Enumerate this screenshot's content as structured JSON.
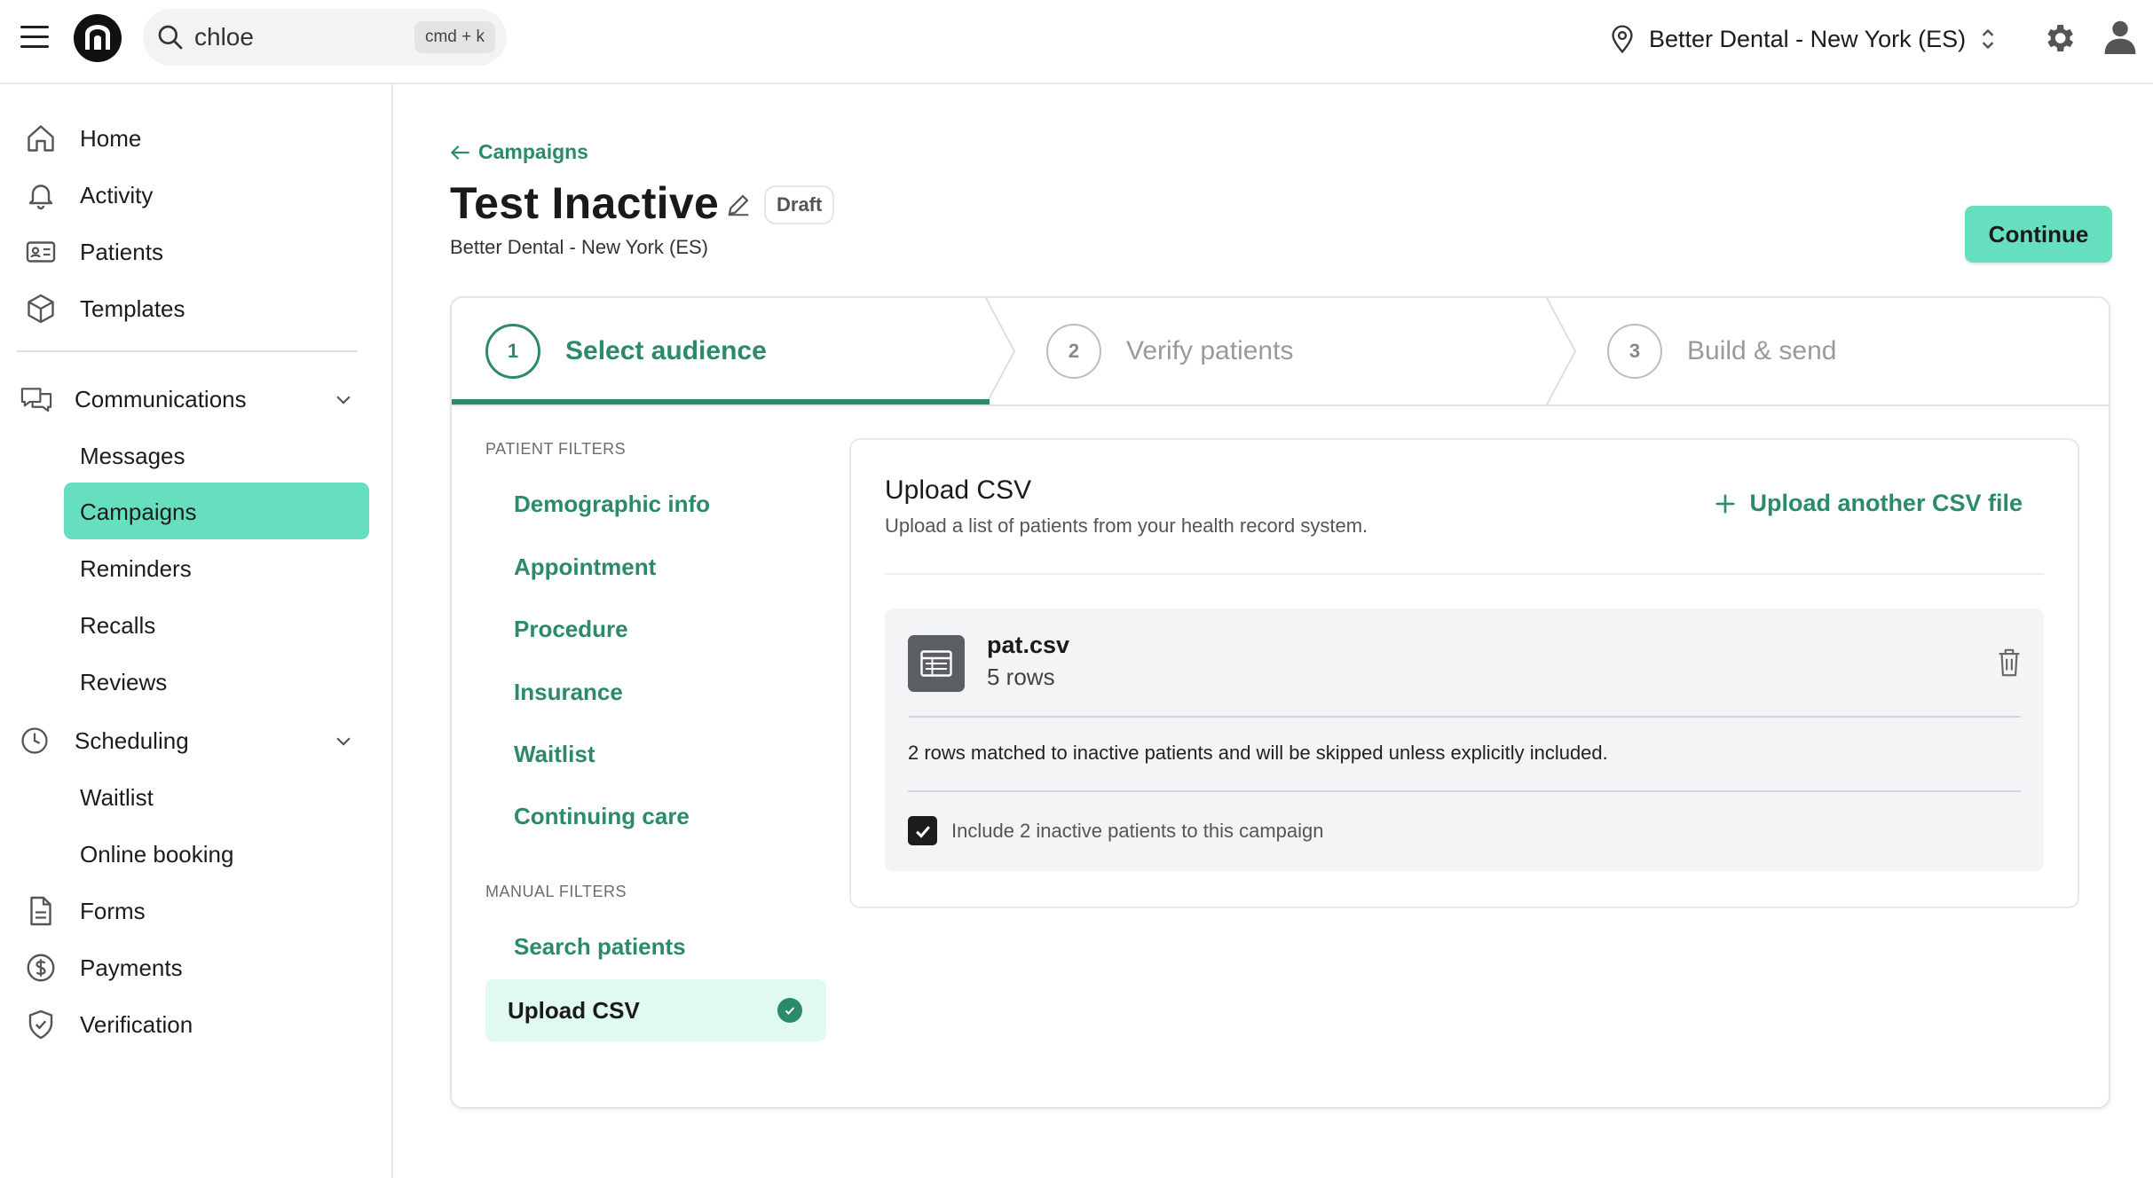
{
  "header": {
    "search_value": "chloe",
    "search_shortcut": "cmd + k",
    "location": "Better Dental - New York (ES)"
  },
  "sidebar": {
    "items": [
      {
        "label": "Home",
        "icon": "home-icon"
      },
      {
        "label": "Activity",
        "icon": "bell-icon"
      },
      {
        "label": "Patients",
        "icon": "id-card-icon"
      },
      {
        "label": "Templates",
        "icon": "cube-icon"
      }
    ],
    "communications": {
      "label": "Communications",
      "children": [
        "Messages",
        "Campaigns",
        "Reminders",
        "Recalls",
        "Reviews"
      ],
      "active": "Campaigns"
    },
    "scheduling": {
      "label": "Scheduling",
      "children": [
        "Waitlist",
        "Online booking"
      ]
    },
    "bottom": [
      {
        "label": "Forms",
        "icon": "document-icon"
      },
      {
        "label": "Payments",
        "icon": "dollar-icon"
      },
      {
        "label": "Verification",
        "icon": "shield-icon"
      }
    ]
  },
  "page": {
    "back_label": "Campaigns",
    "title": "Test Inactive",
    "status": "Draft",
    "subtitle": "Better Dental - New York (ES)",
    "continue_label": "Continue"
  },
  "steps": [
    {
      "num": "1",
      "label": "Select audience",
      "active": true
    },
    {
      "num": "2",
      "label": "Verify patients",
      "active": false
    },
    {
      "num": "3",
      "label": "Build & send",
      "active": false
    }
  ],
  "filters": {
    "patient_label": "PATIENT FILTERS",
    "patient": [
      "Demographic info",
      "Appointment",
      "Procedure",
      "Insurance",
      "Waitlist",
      "Continuing care"
    ],
    "manual_label": "MANUAL FILTERS",
    "manual": [
      "Search patients",
      "Upload CSV"
    ],
    "active": "Upload CSV"
  },
  "upload": {
    "title": "Upload CSV",
    "subtitle": "Upload a list of patients from your health record system.",
    "add_label": "Upload another CSV file",
    "file_name": "pat.csv",
    "file_rows": "5 rows",
    "matched_text": "2 rows matched to inactive patients and will be skipped unless explicitly included.",
    "include_label": "Include 2 inactive patients to this campaign",
    "include_checked": true
  },
  "colors": {
    "accent": "#2b8a6b",
    "mint": "#66dfbf",
    "mint_light": "#e0faf1"
  }
}
